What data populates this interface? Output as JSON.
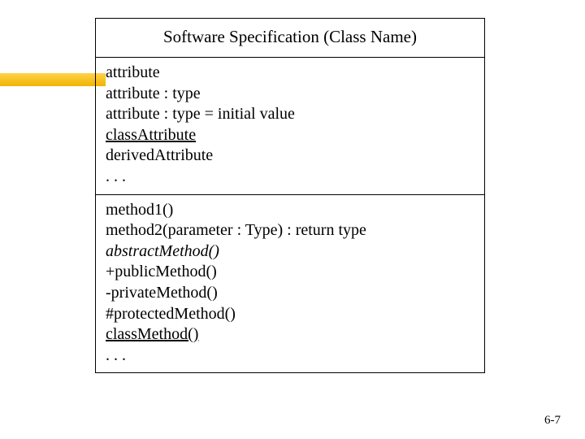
{
  "title": "Software Specification (Class Name)",
  "attributes": {
    "l0": "attribute",
    "l1": "attribute : type",
    "l2": "attribute : type = initial value",
    "l3": "classAttribute",
    "l4": "derivedAttribute",
    "l5": ". . ."
  },
  "methods": {
    "l0": "method1()",
    "l1": "method2(parameter : Type) : return type",
    "l2": "abstractMethod()",
    "l3": "+publicMethod()",
    "l4": "-privateMethod()",
    "l5": "#protectedMethod()",
    "l6": "classMethod()",
    "l7": ". . ."
  },
  "pagenum": "6-7"
}
